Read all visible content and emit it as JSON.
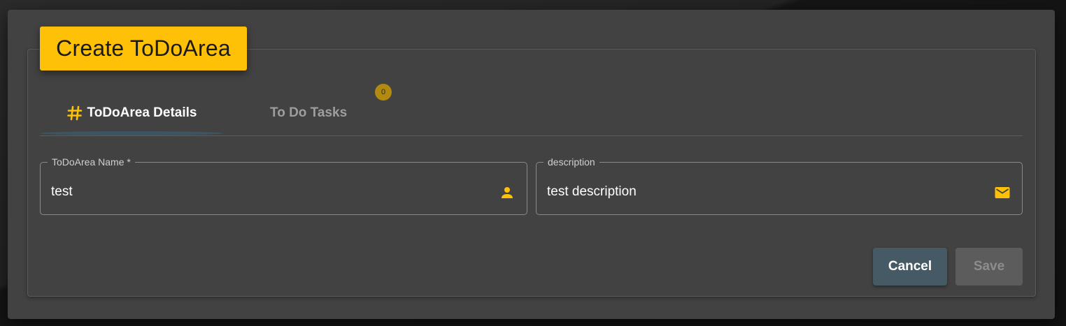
{
  "dialog": {
    "title": "Create ToDoArea"
  },
  "tabs": [
    {
      "label": "ToDoArea Details",
      "icon": "hash-icon",
      "active": true
    },
    {
      "label": "To Do Tasks",
      "badge": "0",
      "active": false
    }
  ],
  "form": {
    "name": {
      "label": "ToDoArea Name *",
      "value": "test",
      "icon": "person-icon"
    },
    "description": {
      "label": "description",
      "value": "test description",
      "icon": "mail-icon"
    }
  },
  "actions": {
    "cancel_label": "Cancel",
    "save_label": "Save",
    "save_disabled": true
  },
  "colors": {
    "accent": "#ffc107",
    "dialog_bg": "#424242",
    "cancel_bg": "#455a64",
    "save_disabled_bg": "#5c5c5c"
  }
}
